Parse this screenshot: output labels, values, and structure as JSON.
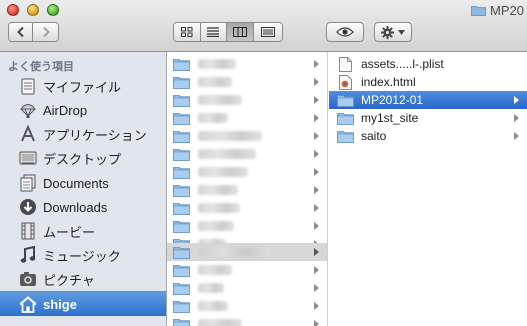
{
  "window": {
    "title": "MP20"
  },
  "toolbar": {
    "back_icon": "chevron-left-icon",
    "forward_icon": "chevron-right-icon",
    "view_modes": [
      "icon-view",
      "list-view",
      "column-view",
      "coverflow-view"
    ],
    "active_view": "column-view",
    "quicklook_icon": "eye-icon",
    "action_icon": "gear-icon"
  },
  "sidebar": {
    "section_header": "よく使う項目",
    "items": [
      {
        "label": "マイファイル",
        "icon": "all-my-files-icon"
      },
      {
        "label": "AirDrop",
        "icon": "airdrop-icon"
      },
      {
        "label": "アプリケーション",
        "icon": "applications-icon"
      },
      {
        "label": "デスクトップ",
        "icon": "desktop-icon"
      },
      {
        "label": "Documents",
        "icon": "documents-icon"
      },
      {
        "label": "Downloads",
        "icon": "downloads-icon"
      },
      {
        "label": "ムービー",
        "icon": "movies-icon"
      },
      {
        "label": "ミュージック",
        "icon": "music-icon"
      },
      {
        "label": "ピクチャ",
        "icon": "pictures-icon"
      },
      {
        "label": "shige",
        "icon": "home-icon",
        "selected": true
      }
    ]
  },
  "column1": {
    "note": "",
    "rows": 17,
    "highlighted_row": 11
  },
  "column2": {
    "items": [
      {
        "name": "assets.....l-.plist",
        "type": "file",
        "icon": "document-icon"
      },
      {
        "name": "index.html",
        "type": "file",
        "icon": "html-file-icon"
      },
      {
        "name": "MP2012-01",
        "type": "folder",
        "icon": "folder-icon",
        "selected": true
      },
      {
        "name": "my1st_site",
        "type": "folder",
        "icon": "folder-icon"
      },
      {
        "name": "saito",
        "type": "folder",
        "icon": "folder-icon"
      }
    ]
  },
  "colors": {
    "selection_blue": "#2b66c7",
    "sidebar_bg": "#e1e6ec",
    "folder_blue": "#7fb0dc"
  }
}
